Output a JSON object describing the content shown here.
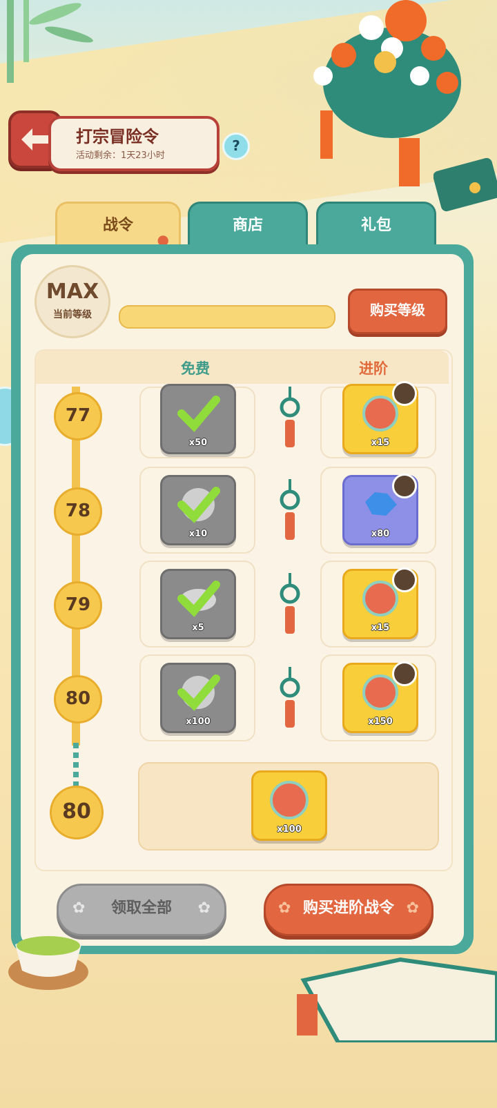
{
  "header": {
    "title": "打宗冒险令",
    "subtitle": "活动剩余：1天23小时",
    "help_label": "?"
  },
  "tabs": [
    {
      "label": "战令",
      "active": true
    },
    {
      "label": "商店",
      "active": false
    },
    {
      "label": "礼包",
      "active": false
    }
  ],
  "level": {
    "current_label": "MAX",
    "current_caption": "当前等级",
    "progress": 1.0,
    "buy_level_label": "购买等级"
  },
  "columns": {
    "free": "免费",
    "advanced": "进阶"
  },
  "rows": [
    {
      "level": "77",
      "free": {
        "icon": "silver-ingot-icon",
        "qty": "x50",
        "claimed": true
      },
      "advanced": {
        "icon": "opera-mask-coin-icon",
        "qty": "x15",
        "locked": true
      }
    },
    {
      "level": "78",
      "free": {
        "icon": "silver-medal-icon",
        "qty": "x10",
        "claimed": true
      },
      "advanced": {
        "icon": "blue-gem-icon",
        "qty": "x80",
        "locked": true
      }
    },
    {
      "level": "79",
      "free": {
        "icon": "silver-ingot-icon",
        "qty": "x5",
        "claimed": true
      },
      "advanced": {
        "icon": "opera-mask-coin-icon",
        "qty": "x15",
        "locked": true
      }
    },
    {
      "level": "80",
      "free": {
        "icon": "silver-medal-icon",
        "qty": "x100",
        "claimed": true
      },
      "advanced": {
        "icon": "opera-mask-coin-icon",
        "qty": "x150",
        "locked": true
      }
    }
  ],
  "final_reward": {
    "level": "80",
    "icon": "opera-mask-coin-icon",
    "qty": "x100"
  },
  "buttons": {
    "claim_all": "领取全部",
    "buy_advanced": "购买进阶战令"
  },
  "colors": {
    "teal": "#4aa99b",
    "orange": "#e2663f",
    "gold": "#f8cf3a",
    "cream": "#fbf3e2"
  }
}
